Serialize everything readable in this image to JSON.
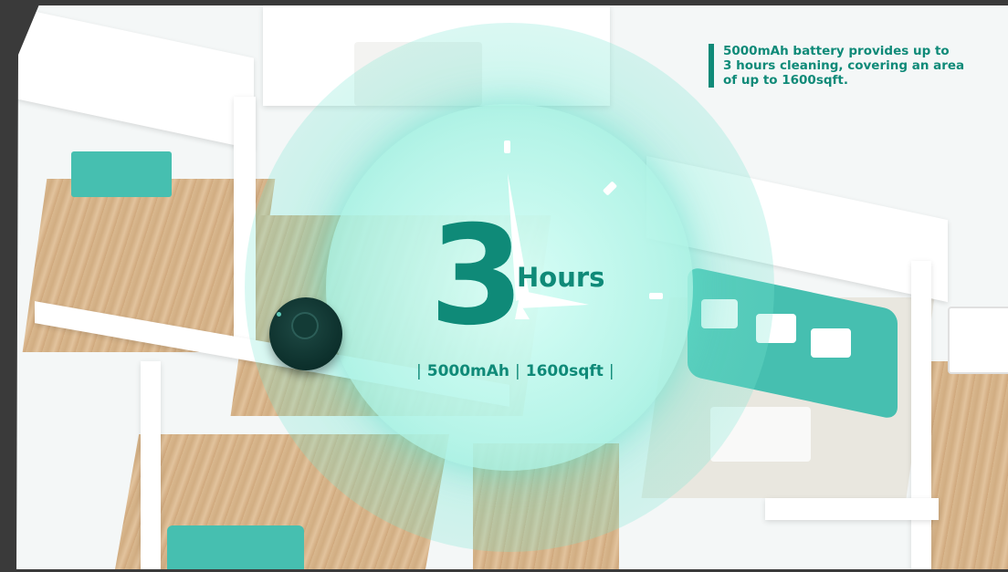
{
  "hero": {
    "number": "3",
    "unit": "Hours",
    "stat_battery": "5000mAh",
    "stat_area": "1600sqft"
  },
  "note": {
    "lines": [
      "5000mAh battery provides up to",
      "3 hours cleaning, covering an area",
      "of up to 1600sqft."
    ]
  },
  "colors": {
    "accent": "#0f8a78",
    "glow": "#7ee6d2",
    "robot": "#0c2f2b",
    "wood": "#d9b88f",
    "sofa": "#46bfb0"
  }
}
